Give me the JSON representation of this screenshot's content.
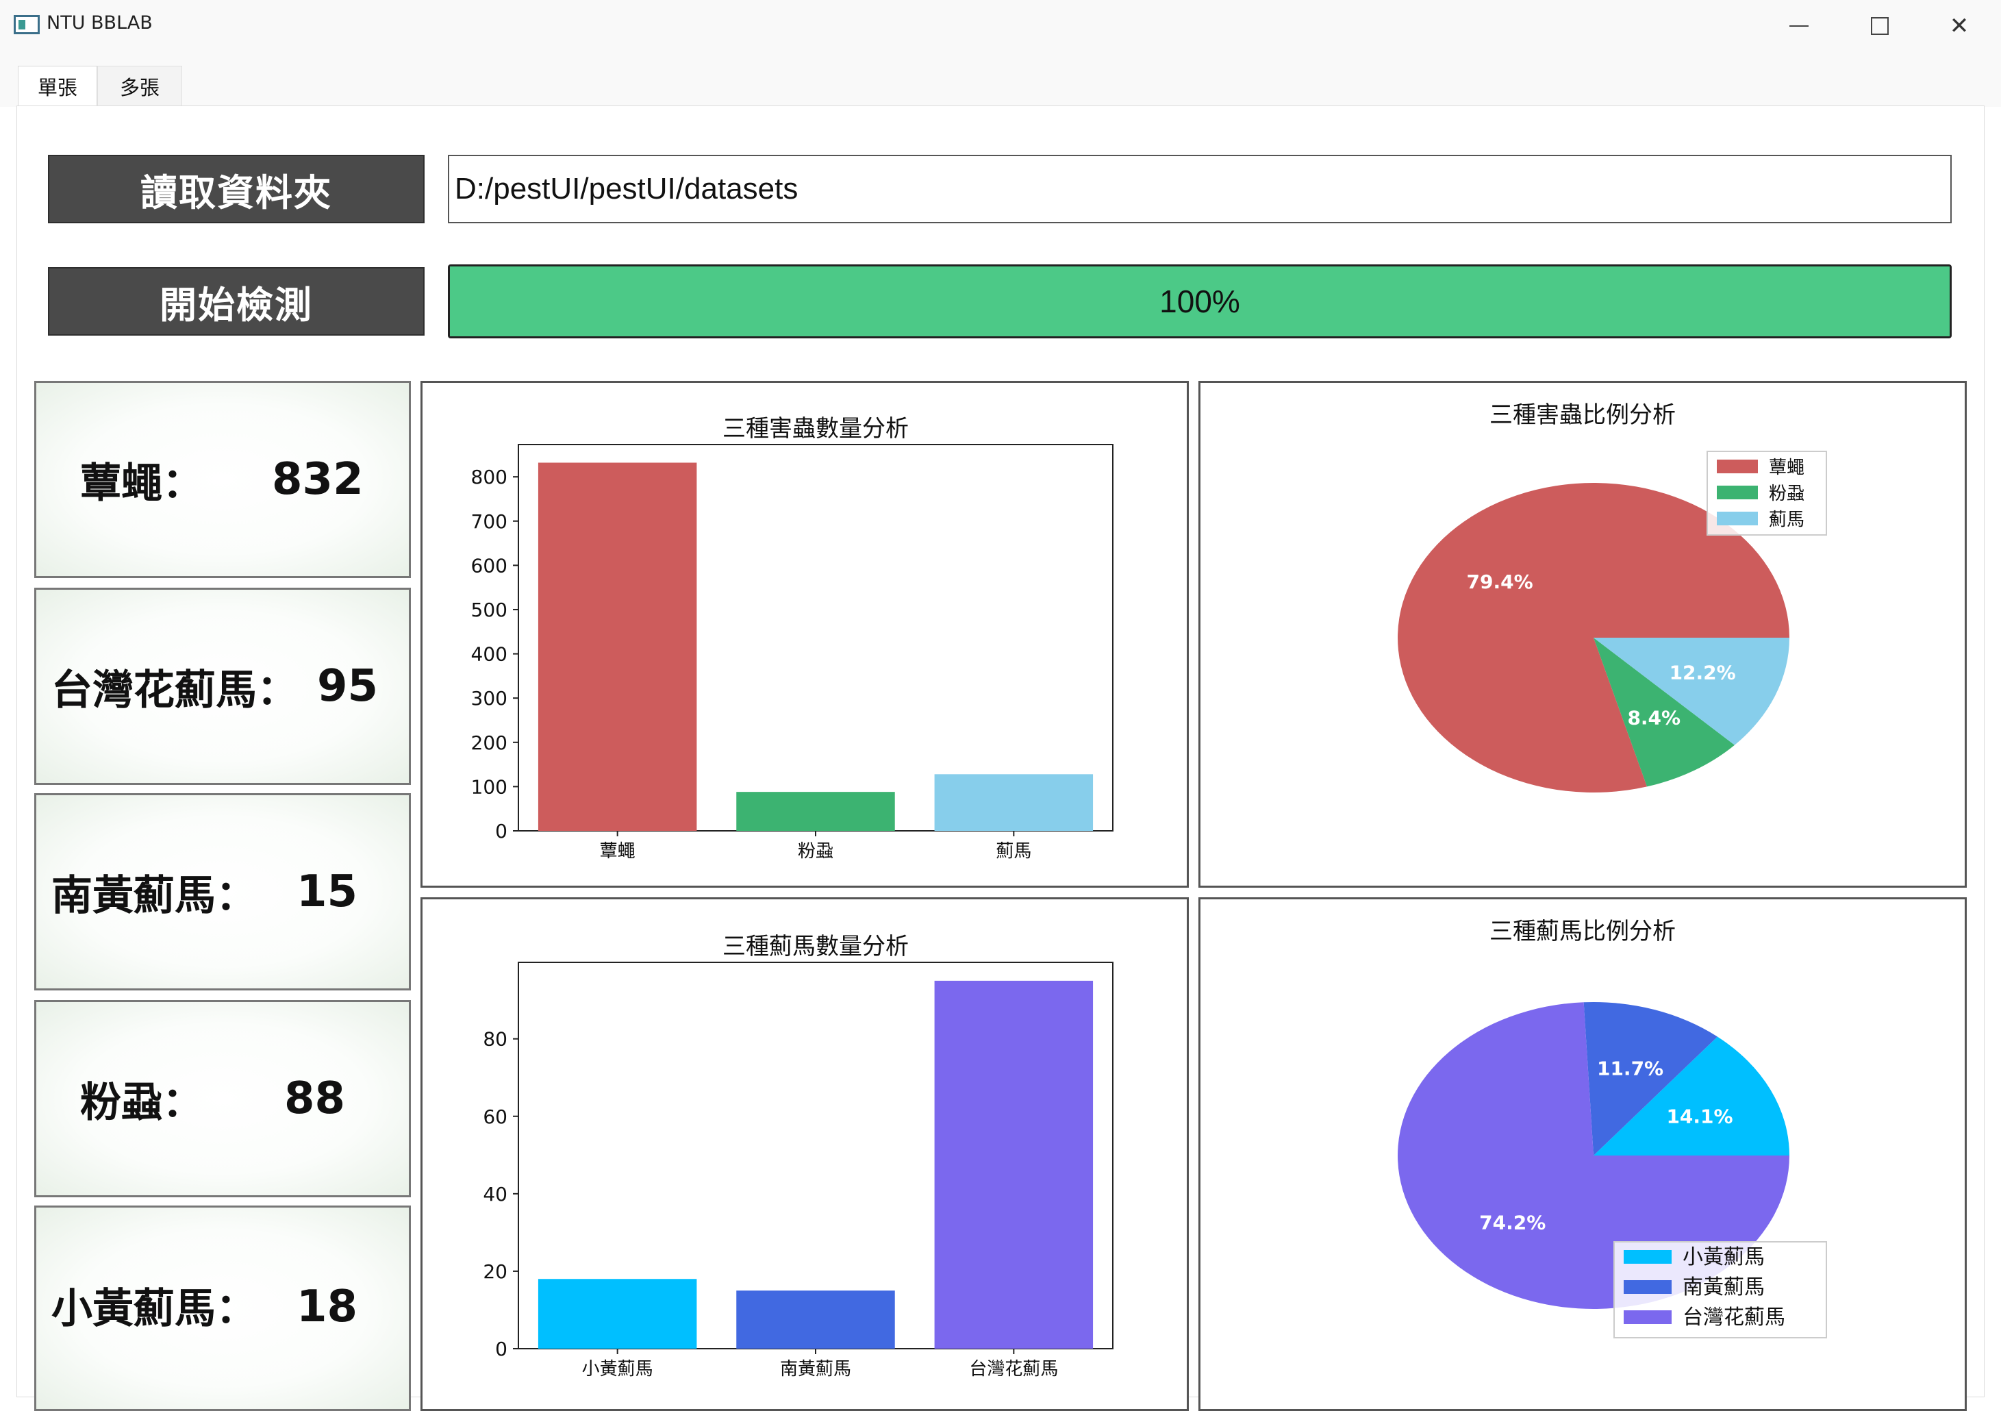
{
  "window": {
    "title": "NTU BBLAB",
    "minimize_icon": "minimize-icon",
    "maximize_icon": "maximize-icon",
    "close_icon": "close-icon"
  },
  "tabs": [
    {
      "label": "單張"
    },
    {
      "label": "多張"
    }
  ],
  "controls": {
    "read_folder_label": "讀取資料夾",
    "start_detect_label": "開始檢測",
    "path_value": "D:/pestUI/pestUI/datasets",
    "progress_percent": 100,
    "progress_text": "100%",
    "accent_color": "#4cc987"
  },
  "counts": [
    {
      "name": "蕈蠅：",
      "value": "832"
    },
    {
      "name": "台灣花薊馬：",
      "value": "95"
    },
    {
      "name": "南黃薊馬：",
      "value": "15"
    },
    {
      "name": "粉蝨：",
      "value": "88"
    },
    {
      "name": "小黃薊馬：",
      "value": "18"
    }
  ],
  "chart_data": [
    {
      "type": "bar",
      "title": "三種害蟲數量分析",
      "categories": [
        "蕈蠅",
        "粉蝨",
        "薊馬"
      ],
      "values": [
        832,
        88,
        128
      ],
      "colors": [
        "#cd5c5c",
        "#3cb371",
        "#87ceeb"
      ],
      "yticks": [
        0,
        100,
        200,
        300,
        400,
        500,
        600,
        700,
        800
      ],
      "ylim": [
        0,
        873
      ],
      "xlabel": "",
      "ylabel": "",
      "grid": false
    },
    {
      "type": "pie",
      "title": "三種害蟲比例分析",
      "labels": [
        "蕈蠅",
        "粉蝨",
        "薊馬"
      ],
      "values": [
        79.4,
        8.4,
        12.2
      ],
      "pct_labels": [
        "79.4%",
        "8.4%",
        "12.2%"
      ],
      "colors": [
        "#cd5c5c",
        "#3cb371",
        "#87ceeb"
      ],
      "legend": "top-right"
    },
    {
      "type": "bar",
      "title": "三種薊馬數量分析",
      "categories": [
        "小黃薊馬",
        "南黃薊馬",
        "台灣花薊馬"
      ],
      "values": [
        18,
        15,
        95
      ],
      "colors": [
        "#00bfff",
        "#4169e1",
        "#7b68ee"
      ],
      "yticks": [
        0,
        20,
        40,
        60,
        80
      ],
      "ylim": [
        0,
        99.75
      ],
      "xlabel": "",
      "ylabel": "",
      "grid": false
    },
    {
      "type": "pie",
      "title": "三種薊馬比例分析",
      "labels": [
        "小黃薊馬",
        "南黃薊馬",
        "台灣花薊馬"
      ],
      "values": [
        14.1,
        11.7,
        74.2
      ],
      "pct_labels": [
        "14.1%",
        "11.7%",
        "74.2%"
      ],
      "colors": [
        "#00bfff",
        "#4169e1",
        "#7b68ee"
      ],
      "legend": "bottom-right"
    }
  ]
}
